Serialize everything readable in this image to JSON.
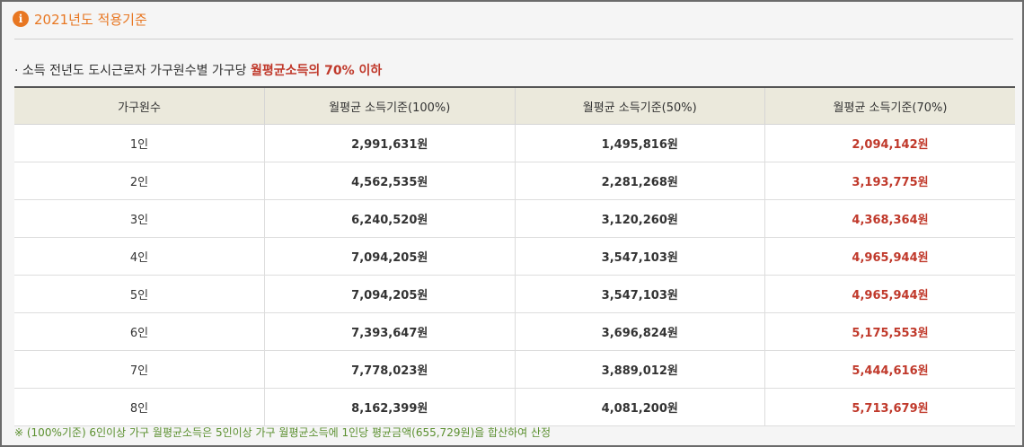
{
  "header": {
    "icon": "info-icon",
    "title": "2021년도 적용기준"
  },
  "summary": {
    "prefix": "· 소득 전년도 도시근로자 가구원수별 가구당 ",
    "highlight": "월평균소득의 70% 이하"
  },
  "table": {
    "columns": [
      "가구원수",
      "월평균 소득기준(100%)",
      "월평균 소득기준(50%)",
      "월평균 소득기준(70%)"
    ],
    "rows": [
      [
        "1인",
        "2,991,631원",
        "1,495,816원",
        "2,094,142원"
      ],
      [
        "2인",
        "4,562,535원",
        "2,281,268원",
        "3,193,775원"
      ],
      [
        "3인",
        "6,240,520원",
        "3,120,260원",
        "4,368,364원"
      ],
      [
        "4인",
        "7,094,205원",
        "3,547,103원",
        "4,965,944원"
      ],
      [
        "5인",
        "7,094,205원",
        "3,547,103원",
        "4,965,944원"
      ],
      [
        "6인",
        "7,393,647원",
        "3,696,824원",
        "5,175,553원"
      ],
      [
        "7인",
        "7,778,023원",
        "3,889,012원",
        "5,444,616원"
      ],
      [
        "8인",
        "8,162,399원",
        "4,081,200원",
        "5,713,679원"
      ]
    ]
  },
  "footnote": "※ (100%기준) 6인이상 가구 월평균소득은 5인이상 가구 월평균소득에 1인당 평균금액(655,729원)을 합산하여 산정",
  "colors": {
    "accent": "#e87722",
    "highlight": "#c0392b",
    "note": "#5a8f2e",
    "header_bg": "#ebe9dc"
  }
}
